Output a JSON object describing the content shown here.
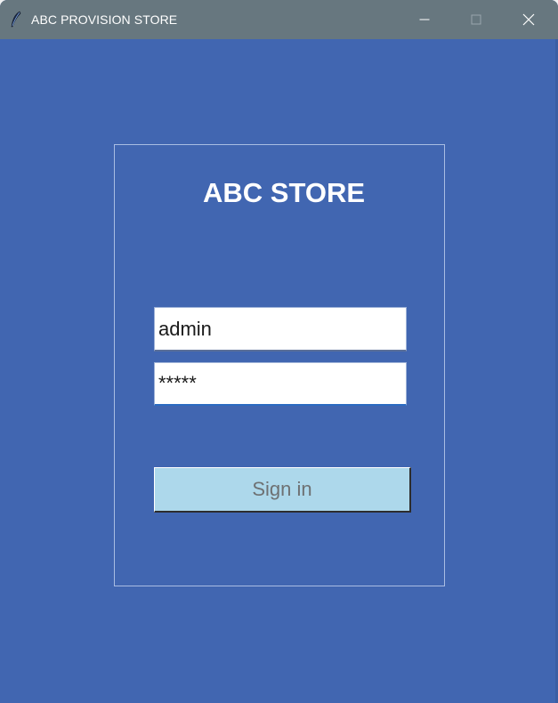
{
  "window": {
    "title": "ABC PROVISION STORE",
    "icon": "feather-icon",
    "controls": {
      "minimize": "minimize-icon",
      "maximize": "maximize-icon",
      "close": "close-icon"
    }
  },
  "login": {
    "heading": "ABC STORE",
    "username_value": "admin",
    "password_value": "*****",
    "signin_label": "Sign in"
  },
  "colors": {
    "background": "#4166b1",
    "titlebar": "#67777f",
    "button": "#add8eb"
  }
}
